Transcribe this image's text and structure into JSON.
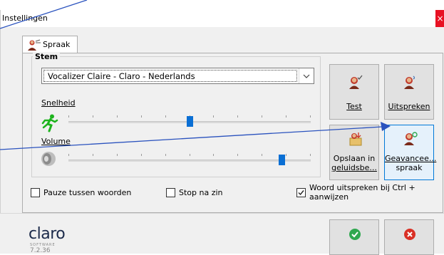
{
  "window": {
    "title": "Instellingen",
    "close_glyph": "×"
  },
  "tabs": [
    {
      "label": "Spraak",
      "icon": "speaker-person-icon",
      "active": true
    }
  ],
  "stem": {
    "group_title": "Stem",
    "voice_selected": "Vocalizer Claire - Claro - Nederlands",
    "speed_label": "Snelheid",
    "speed_value": 0.5,
    "volume_label": "Volume",
    "volume_value": 0.89
  },
  "buttons": {
    "test": "Test",
    "speak": "Uitspreken",
    "save_audio_line1": "Opslaan in",
    "save_audio_line2": "geluidsbe...",
    "advanced_line1": "Geavancee...",
    "advanced_line2": "spraak"
  },
  "checkboxes": {
    "pause_words": {
      "label": "Pauze tussen woorden",
      "checked": false
    },
    "stop_sentence": {
      "label": "Stop na zin",
      "checked": false
    },
    "speak_word_line1": "Woord uitspreken bij Ctrl +",
    "speak_word_line2": "aanwijzen",
    "speak_word_checked": true
  },
  "footer": {
    "brand": "claro",
    "brand_sub": "SOFTWARE",
    "version": "7.2.36"
  },
  "colors": {
    "accent": "#0078d7",
    "slider_thumb": "#0a6fd4",
    "ok_green": "#2fa84f",
    "cancel_red": "#d93025",
    "close_red": "#e81123",
    "arrow_blue": "#2a52be"
  }
}
